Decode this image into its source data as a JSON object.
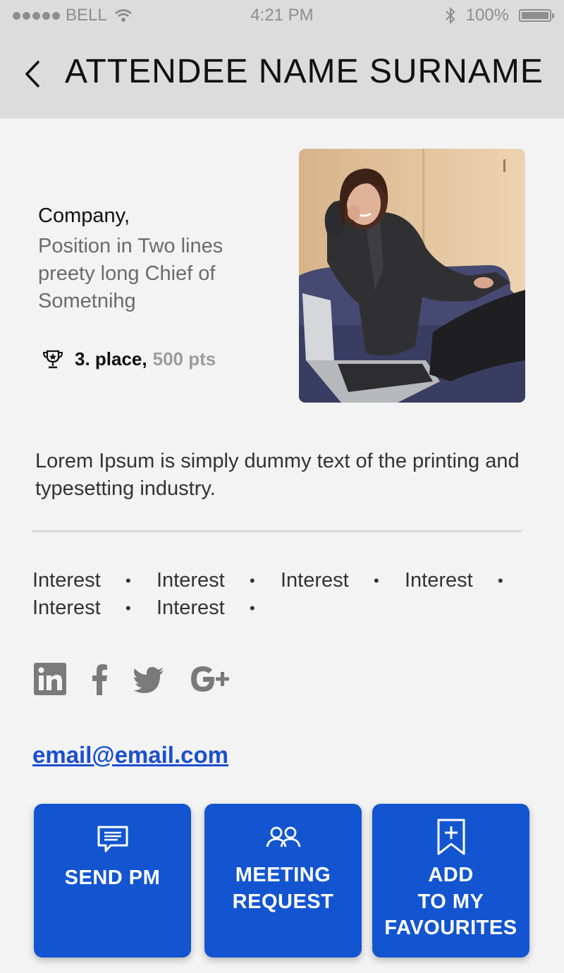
{
  "status_bar": {
    "carrier": "BELL",
    "time": "4:21 PM",
    "battery": "100%",
    "battery_level": 1.0
  },
  "header": {
    "title": "ATTENDEE NAME SURNAME",
    "back_icon": "chevron-left-icon"
  },
  "profile": {
    "company": "Company,",
    "position": "Position in Two lines preety long Chief of Sometnihg",
    "rank_place": "3. place,",
    "rank_points": "500 pts",
    "trophy_icon": "trophy-icon",
    "bio": "Lorem Ipsum is simply dummy text of the printing and typesetting industry."
  },
  "interests": [
    "Interest",
    "Interest",
    "Interest",
    "Interest",
    "Interest",
    "Interest"
  ],
  "social": [
    "linkedin-icon",
    "facebook-icon",
    "twitter-icon",
    "google-plus-icon"
  ],
  "email": "email@email.com",
  "actions": {
    "send_pm": "SEND PM",
    "meeting_line1": "MEETING",
    "meeting_line2": "REQUEST",
    "fav_line1": "ADD",
    "fav_line2": "TO MY",
    "fav_line3": "FAVOURITES"
  },
  "colors": {
    "accent": "#1355d0",
    "header_bg": "#dcdcdc",
    "page_bg": "#f3f3f3",
    "link": "#1a4fd0"
  }
}
